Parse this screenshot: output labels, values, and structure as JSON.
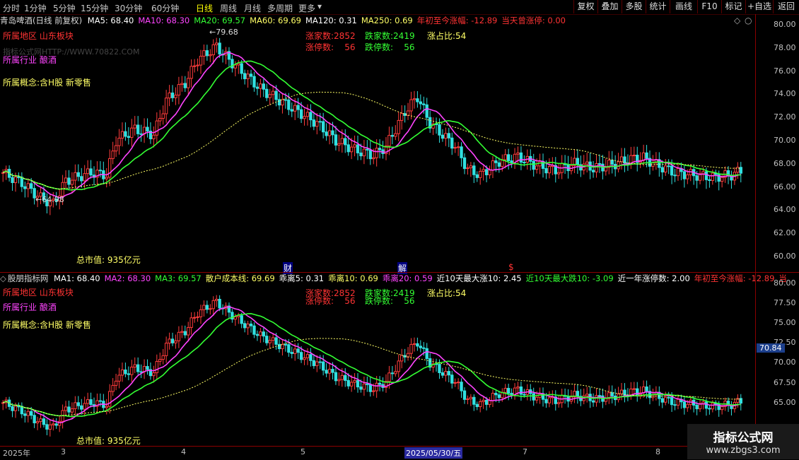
{
  "toolbar": {
    "timeframes": [
      "分时",
      "1分钟",
      "5分钟",
      "15分钟",
      "30分钟",
      "60分钟",
      "日线",
      "周线",
      "月线",
      "多周期",
      "更多"
    ],
    "active": "日线",
    "right_buttons": [
      "复权",
      "叠加",
      "多股",
      "统计",
      "画线",
      "F10",
      "标记",
      "+自选",
      "返回"
    ]
  },
  "upper": {
    "title": "青岛啤酒(日线 前复权)",
    "ma": [
      {
        "label": "MA5: 68.40",
        "color": "#ffffff"
      },
      {
        "label": "MA10: 68.30",
        "color": "#ff44ff"
      },
      {
        "label": "MA20: 69.57",
        "color": "#33ff33"
      },
      {
        "label": "MA60: 69.69",
        "color": "#ffff66"
      },
      {
        "label": "MA120: 0.31",
        "color": "#ffffff"
      },
      {
        "label": "MA250: 0.69",
        "color": "#ffff66"
      },
      {
        "label": "年初至今涨幅: -12.89",
        "color": "#ff3333"
      },
      {
        "label": "当天曾涨停: 0.00",
        "color": "#ff3333"
      }
    ],
    "region": "所属地区 山东板块",
    "industry": "所属行业 酿酒",
    "concept": "所属概念:含H股 新零售",
    "watermark": "指标公式网HTTP://WWW.70822.COM",
    "stats": {
      "up_count": "涨家数:2852",
      "down_count": "跌家数:2419",
      "up_ratio": "涨占比:54",
      "limit_up": "涨停数:    56",
      "limit_down": "跌停数:    56"
    },
    "market_cap": "总市值: 935亿元",
    "high_label": "79.68",
    "low_label": "64.98",
    "yticks": [
      "80.00",
      "78.00",
      "76.00",
      "74.00",
      "72.00",
      "70.00",
      "68.00",
      "66.00",
      "64.00",
      "62.00",
      "60.00"
    ]
  },
  "lower": {
    "title": "股朋指标网",
    "items": [
      {
        "label": "MA1: 68.40",
        "color": "#ffffff"
      },
      {
        "label": "MA2: 68.30",
        "color": "#ff44ff"
      },
      {
        "label": "MA3: 69.57",
        "color": "#33ff33"
      },
      {
        "label": "散户成本线: 69.69",
        "color": "#ffff66"
      },
      {
        "label": "乖离5: 0.31",
        "color": "#ffffff"
      },
      {
        "label": "乖离10: 0.69",
        "color": "#ffff66"
      },
      {
        "label": "乖离20: 0.59",
        "color": "#ff44ff"
      },
      {
        "label": "近10天最大涨10: 2.45",
        "color": "#ffffff"
      },
      {
        "label": "近10天最大跌10: -3.09",
        "color": "#33ff33"
      },
      {
        "label": "近一年涨停数: 2.00",
        "color": "#ffffff"
      },
      {
        "label": "年初至今涨幅: -12.89",
        "color": "#ff3333"
      },
      {
        "label": "当",
        "color": "#ff3333"
      }
    ],
    "yticks": [
      "80.00",
      "77.50",
      "75.00",
      "72.50",
      "70.00",
      "67.50",
      "65.00"
    ],
    "price_tag": "70.84"
  },
  "events": [
    "财",
    "解",
    "$"
  ],
  "xaxis": {
    "labels": [
      "2025年",
      "3",
      "4",
      "5",
      "2025/05/30/五",
      "7",
      "8"
    ]
  },
  "logo": {
    "line1": "指标公式网",
    "line2": "www.zbgs3.com"
  }
}
